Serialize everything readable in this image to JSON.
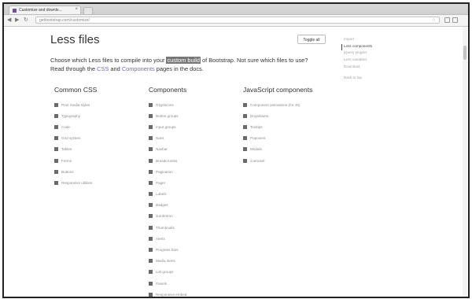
{
  "browser": {
    "tab_title": "Customize and downlo...",
    "tab_close": "×",
    "url": "getbootstrap.com/customize/",
    "back": "◀",
    "forward": "▶",
    "reload": "↻",
    "star": "☆"
  },
  "page": {
    "title": "Less files",
    "toggle_label": "Toggle all",
    "intro_1": "Choose which Less files to compile into your ",
    "intro_highlight": "custom build",
    "intro_2": " of Bootstrap. Not sure which files to use? Read through the ",
    "intro_link_css": "CSS",
    "intro_3": " and ",
    "intro_link_components": "Components",
    "intro_4": " pages in the docs."
  },
  "columns": [
    {
      "heading": "Common CSS",
      "items": [
        "Print media styles",
        "Typography",
        "Code",
        "Grid system",
        "Tables",
        "Forms",
        "Buttons",
        "Responsive utilities"
      ]
    },
    {
      "heading": "Components",
      "items": [
        "Glyphicons",
        "Button groups",
        "Input groups",
        "Navs",
        "Navbar",
        "Breadcrumbs",
        "Pagination",
        "Pager",
        "Labels",
        "Badges",
        "Jumbotron",
        "Thumbnails",
        "Alerts",
        "Progress bars",
        "Media items",
        "List groups",
        "Panels",
        "Responsive embed"
      ]
    },
    {
      "heading": "JavaScript components",
      "items": [
        "Component animations (for JS)",
        "Dropdowns",
        "Tooltips",
        "Popovers",
        "Modals",
        "Carousel"
      ]
    }
  ],
  "sidenav": {
    "items": [
      "Import",
      "Less components",
      "jQuery plugins",
      "Less variables",
      "Download"
    ],
    "active_index": 1,
    "back_to_top": "Back to top"
  },
  "colors": {
    "accent": "#6b4fa3",
    "link": "#7a6aa8",
    "highlight": "#777777"
  }
}
